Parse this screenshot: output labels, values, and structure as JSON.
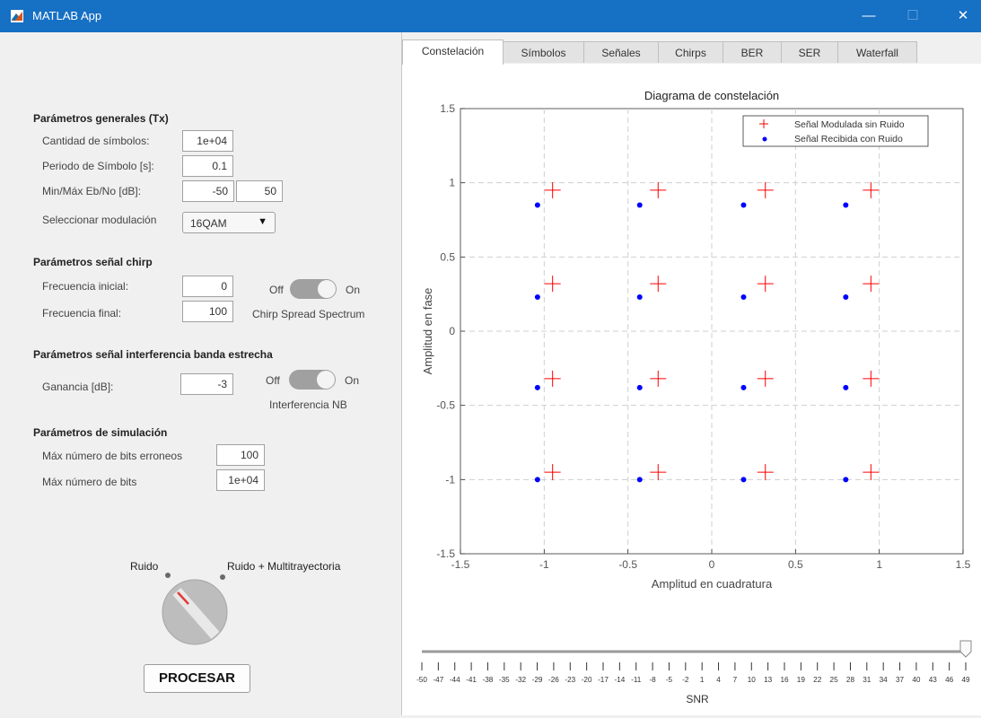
{
  "window": {
    "title": "MATLAB App",
    "minimize": "—",
    "maximize": "☐",
    "close": "✕"
  },
  "general": {
    "heading": "Parámetros generales (Tx)",
    "symbols_label": "Cantidad de símbolos:",
    "symbols_value": "1e+04",
    "period_label": "Periodo de Símbolo [s]:",
    "period_value": "0.1",
    "ebno_label": "Min/Máx Eb/No [dB]:",
    "ebno_min": "-50",
    "ebno_max": "50",
    "mod_label": "Seleccionar modulación",
    "mod_value": "16QAM"
  },
  "chirp": {
    "heading": "Parámetros señal chirp",
    "f0_label": "Frecuencia inicial:",
    "f0_value": "0",
    "f1_label": "Frecuencia final:",
    "f1_value": "100",
    "switch_off": "Off",
    "switch_on": "On",
    "switch_caption": "Chirp Spread Spectrum"
  },
  "interference": {
    "heading": "Parámetros señal interferencia banda estrecha",
    "gain_label": "Ganancia [dB]:",
    "gain_value": "-3",
    "switch_off": "Off",
    "switch_on": "On",
    "switch_caption": "Interferencia NB"
  },
  "simulation": {
    "heading": "Parámetros de simulación",
    "maxerr_label": "Máx número de bits erroneos",
    "maxerr_value": "100",
    "maxbits_label": "Máx número de bits",
    "maxbits_value": "1e+04"
  },
  "knob": {
    "label_left": "Ruido",
    "label_right": "Ruido + Multitrayectoria"
  },
  "process_button": "PROCESAR",
  "tabs": [
    "Constelación",
    "Símbolos",
    "Señales",
    "Chirps",
    "BER",
    "SER",
    "Waterfall"
  ],
  "slider": {
    "label": "SNR",
    "value": 49,
    "ticks": [
      "-50",
      "-47",
      "-44",
      "-41",
      "-38",
      "-35",
      "-32",
      "-29",
      "-26",
      "-23",
      "-20",
      "-17",
      "-14",
      "-11",
      "-8",
      "-5",
      "-2",
      "1",
      "4",
      "7",
      "10",
      "13",
      "16",
      "19",
      "22",
      "25",
      "28",
      "31",
      "34",
      "37",
      "40",
      "43",
      "46",
      "49"
    ]
  },
  "chart_data": {
    "type": "scatter",
    "title": "Diagrama de constelación",
    "xlabel": "Amplitud en cuadratura",
    "ylabel": "Amplitud en fase",
    "xlim": [
      -1.5,
      1.5
    ],
    "ylim": [
      -1.5,
      1.5
    ],
    "xticks": [
      "-1.5",
      "-1",
      "-0.5",
      "0",
      "0.5",
      "1",
      "1.5"
    ],
    "yticks": [
      "-1.5",
      "-1",
      "-0.5",
      "0",
      "0.5",
      "1",
      "1.5"
    ],
    "grid": true,
    "legend_position": "top-right",
    "series": [
      {
        "name": "Señal Modulada sin Ruido",
        "marker": "plus",
        "color": "#ff0000",
        "x": [
          -0.95,
          -0.32,
          0.32,
          0.95,
          -0.95,
          -0.32,
          0.32,
          0.95,
          -0.95,
          -0.32,
          0.32,
          0.95,
          -0.95,
          -0.32,
          0.32,
          0.95
        ],
        "y": [
          0.95,
          0.95,
          0.95,
          0.95,
          0.32,
          0.32,
          0.32,
          0.32,
          -0.32,
          -0.32,
          -0.32,
          -0.32,
          -0.95,
          -0.95,
          -0.95,
          -0.95
        ]
      },
      {
        "name": "Señal Recibida con Ruido",
        "marker": "dot",
        "color": "#0000ff",
        "x": [
          -1.04,
          -0.43,
          0.19,
          0.8,
          -1.04,
          -0.43,
          0.19,
          0.8,
          -1.04,
          -0.43,
          0.19,
          0.8,
          -1.04,
          -0.43,
          0.19,
          0.8
        ],
        "y": [
          0.85,
          0.85,
          0.85,
          0.85,
          0.23,
          0.23,
          0.23,
          0.23,
          -0.38,
          -0.38,
          -0.38,
          -0.38,
          -1.0,
          -1.0,
          -1.0,
          -1.0
        ]
      }
    ]
  }
}
